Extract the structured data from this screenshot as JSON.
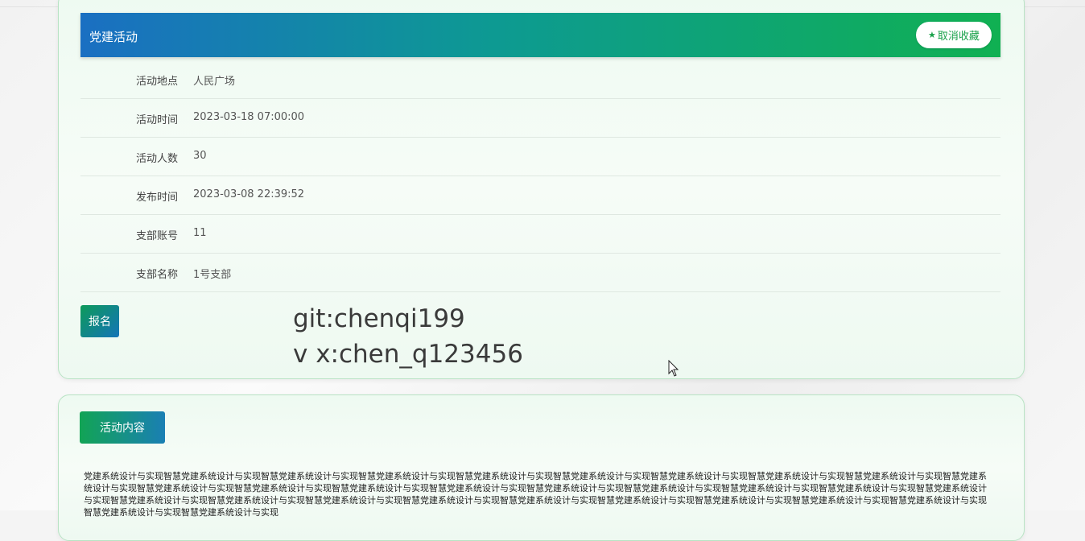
{
  "header": {
    "title": "党建活动",
    "favorite_label": "取消收藏",
    "star_icon": "★"
  },
  "details": [
    {
      "label": "活动地点",
      "value": "人民广场"
    },
    {
      "label": "活动时间",
      "value": "2023-03-18 07:00:00"
    },
    {
      "label": "活动人数",
      "value": "30"
    },
    {
      "label": "发布时间",
      "value": "2023-03-08 22:39:52"
    },
    {
      "label": "支部账号",
      "value": "11"
    },
    {
      "label": "支部名称",
      "value": "1号支部"
    }
  ],
  "signup_label": "报名",
  "watermark": {
    "line1": "git:chenqi199",
    "line2": "v x:chen_q123456"
  },
  "content": {
    "tab_label": "活动内容",
    "text": "党建系统设计与实现智慧党建系统设计与实现智慧党建系统设计与实现智慧党建系统设计与实现智慧党建系统设计与实现智慧党建系统设计与实现智慧党建系统设计与实现智慧党建系统设计与实现智慧党建系统设计与实现智慧党建系统设计与实现智慧党建系统设计与实现智慧党建系统设计与实现智慧党建系统设计与实现智慧党建系统设计与实现智慧党建系统设计与实现智慧党建系统设计与实现智慧党建系统设计与实现智慧党建系统设计与实现智慧党建系统设计与实现智慧党建系统设计与实现智慧党建系统设计与实现智慧党建系统设计与实现智慧党建系统设计与实现智慧党建系统设计与实现智慧党建系统设计与实现智慧党建系统设计与实现智慧党建系统设计与实现智慧党建系统设计与实现智慧党建系统设计与实现智慧党建系统设计与实现"
  },
  "colors": {
    "accent_green": "#10b052",
    "accent_blue": "#1a6fc2"
  }
}
